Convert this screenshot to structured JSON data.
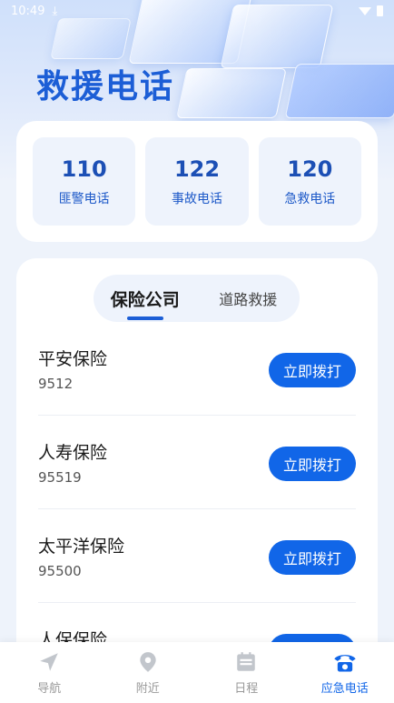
{
  "status_bar": {
    "time": "10:49"
  },
  "page_title": "救援电话",
  "quick_calls": [
    {
      "number": "110",
      "label": "匪警电话"
    },
    {
      "number": "122",
      "label": "事故电话"
    },
    {
      "number": "120",
      "label": "急救电话"
    }
  ],
  "tabs": [
    {
      "label": "保险公司",
      "active": true
    },
    {
      "label": "道路救援",
      "active": false
    }
  ],
  "entries": [
    {
      "name": "平安保险",
      "phone": "9512",
      "button": "立即拨打"
    },
    {
      "name": "人寿保险",
      "phone": "95519",
      "button": "立即拨打"
    },
    {
      "name": "太平洋保险",
      "phone": "95500",
      "button": "立即拨打"
    },
    {
      "name": "人保保险",
      "phone": "",
      "button": "立即拨打"
    }
  ],
  "bottom_nav": [
    {
      "label": "导航",
      "icon": "navigation-arrow-icon",
      "active": false
    },
    {
      "label": "附近",
      "icon": "location-pin-icon",
      "active": false
    },
    {
      "label": "日程",
      "icon": "calendar-icon",
      "active": false
    },
    {
      "label": "应急电话",
      "icon": "phone-icon",
      "active": true
    }
  ],
  "colors": {
    "accent": "#1166e8",
    "title": "#1c5ed6",
    "nav_inactive": "#c2c6cc"
  }
}
